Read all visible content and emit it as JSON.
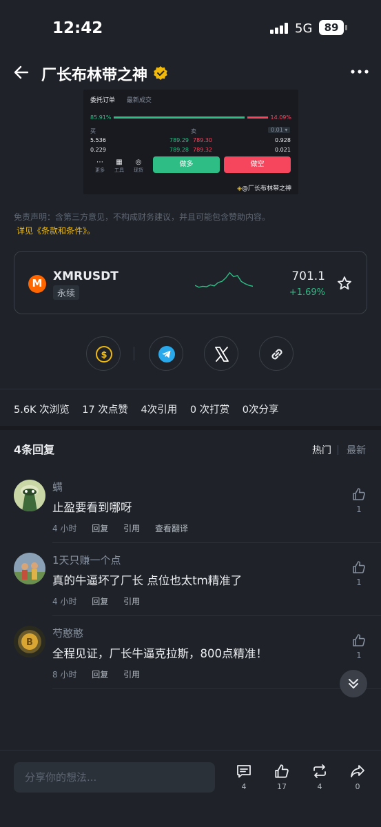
{
  "status_bar": {
    "time": "12:42",
    "network": "5G",
    "battery": "89"
  },
  "header": {
    "title": "厂长布林带之神"
  },
  "screenshot": {
    "tab_active": "委托订单",
    "tab_other": "最新成交",
    "buy_pct": "85.91%",
    "sell_pct": "14.09%",
    "head_buy": "买",
    "head_sell": "卖",
    "precision": "0.01",
    "rows": [
      {
        "qty_l": "5.536",
        "bid": "789.29",
        "ask": "789.30",
        "qty_r": "0.928"
      },
      {
        "qty_l": "0.229",
        "bid": "789.28",
        "ask": "789.32",
        "qty_r": "0.021"
      }
    ],
    "tool_more": "更多",
    "tool_tools": "工具",
    "tool_spot": "现货",
    "buy_label": "做多",
    "sell_label": "做空",
    "watermark": "@厂长布林带之神"
  },
  "disclaimer": {
    "text": "免责声明：含第三方意见，不构成财务建议，并且可能包含赞助内容。",
    "link": "详见《条款和条件》。"
  },
  "ticker": {
    "symbol": "XMRUSDT",
    "type": "永续",
    "price": "701.1",
    "change": "+1.69%",
    "spark": [
      0.62,
      0.7,
      0.66,
      0.68,
      0.6,
      0.64,
      0.5,
      0.45,
      0.3,
      0.08,
      0.25,
      0.2,
      0.45,
      0.55,
      0.62,
      0.66
    ],
    "color_up": "#2ebd85"
  },
  "share": {
    "icons": [
      "coin-icon",
      "telegram-icon",
      "x-icon",
      "link-icon"
    ]
  },
  "stats": {
    "views": "5.6K 次浏览",
    "likes": "17 次点赞",
    "quotes": "4次引用",
    "tips": "0 次打赏",
    "shares": "0次分享"
  },
  "replies": {
    "count": "4条回复",
    "sort_hot": "热门",
    "sort_new": "最新",
    "items": [
      {
        "name": "螨",
        "body": "止盈要看到哪呀",
        "time": "4 小时",
        "reply": "回复",
        "quote": "引用",
        "translate": "查看翻译",
        "likes": "1"
      },
      {
        "name": "1天只赚一个点",
        "body": "真的牛逼坏了厂长 点位也太tm精准了",
        "time": "4 小时",
        "reply": "回复",
        "quote": "引用",
        "likes": "1"
      },
      {
        "name": "芍憨憨",
        "body": "全程见证，厂长牛逼克拉斯，800点精准！",
        "time": "8 小时",
        "reply": "回复",
        "quote": "引用",
        "likes": "1"
      }
    ]
  },
  "bottom": {
    "placeholder": "分享你的想法...",
    "comments": "4",
    "likes": "17",
    "reposts": "4",
    "shares": "0"
  },
  "colors": {
    "accent": "#f0b90b",
    "up": "#2ebd85",
    "down": "#f6465d",
    "bg": "#1f2329"
  }
}
